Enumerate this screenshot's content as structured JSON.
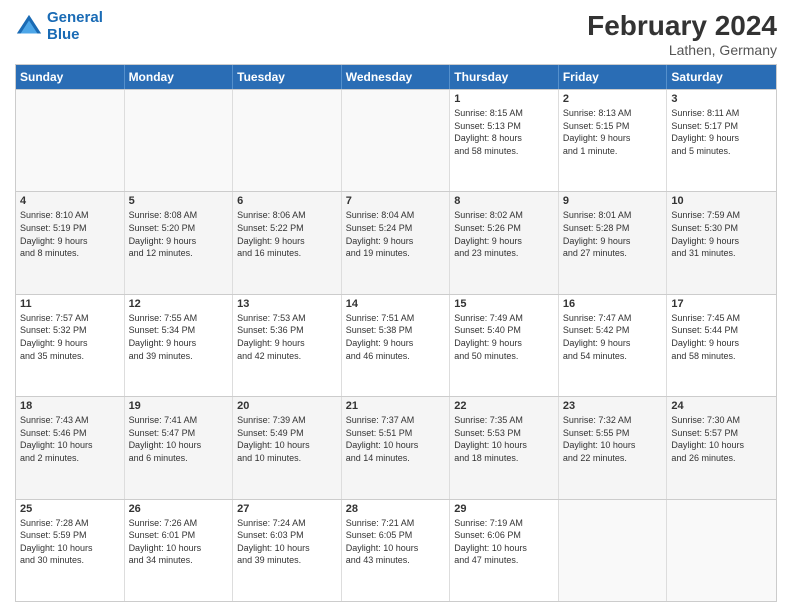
{
  "logo": {
    "line1": "General",
    "line2": "Blue"
  },
  "title": "February 2024",
  "location": "Lathen, Germany",
  "days_header": [
    "Sunday",
    "Monday",
    "Tuesday",
    "Wednesday",
    "Thursday",
    "Friday",
    "Saturday"
  ],
  "weeks": [
    [
      {
        "day": "",
        "info": ""
      },
      {
        "day": "",
        "info": ""
      },
      {
        "day": "",
        "info": ""
      },
      {
        "day": "",
        "info": ""
      },
      {
        "day": "1",
        "info": "Sunrise: 8:15 AM\nSunset: 5:13 PM\nDaylight: 8 hours\nand 58 minutes."
      },
      {
        "day": "2",
        "info": "Sunrise: 8:13 AM\nSunset: 5:15 PM\nDaylight: 9 hours\nand 1 minute."
      },
      {
        "day": "3",
        "info": "Sunrise: 8:11 AM\nSunset: 5:17 PM\nDaylight: 9 hours\nand 5 minutes."
      }
    ],
    [
      {
        "day": "4",
        "info": "Sunrise: 8:10 AM\nSunset: 5:19 PM\nDaylight: 9 hours\nand 8 minutes."
      },
      {
        "day": "5",
        "info": "Sunrise: 8:08 AM\nSunset: 5:20 PM\nDaylight: 9 hours\nand 12 minutes."
      },
      {
        "day": "6",
        "info": "Sunrise: 8:06 AM\nSunset: 5:22 PM\nDaylight: 9 hours\nand 16 minutes."
      },
      {
        "day": "7",
        "info": "Sunrise: 8:04 AM\nSunset: 5:24 PM\nDaylight: 9 hours\nand 19 minutes."
      },
      {
        "day": "8",
        "info": "Sunrise: 8:02 AM\nSunset: 5:26 PM\nDaylight: 9 hours\nand 23 minutes."
      },
      {
        "day": "9",
        "info": "Sunrise: 8:01 AM\nSunset: 5:28 PM\nDaylight: 9 hours\nand 27 minutes."
      },
      {
        "day": "10",
        "info": "Sunrise: 7:59 AM\nSunset: 5:30 PM\nDaylight: 9 hours\nand 31 minutes."
      }
    ],
    [
      {
        "day": "11",
        "info": "Sunrise: 7:57 AM\nSunset: 5:32 PM\nDaylight: 9 hours\nand 35 minutes."
      },
      {
        "day": "12",
        "info": "Sunrise: 7:55 AM\nSunset: 5:34 PM\nDaylight: 9 hours\nand 39 minutes."
      },
      {
        "day": "13",
        "info": "Sunrise: 7:53 AM\nSunset: 5:36 PM\nDaylight: 9 hours\nand 42 minutes."
      },
      {
        "day": "14",
        "info": "Sunrise: 7:51 AM\nSunset: 5:38 PM\nDaylight: 9 hours\nand 46 minutes."
      },
      {
        "day": "15",
        "info": "Sunrise: 7:49 AM\nSunset: 5:40 PM\nDaylight: 9 hours\nand 50 minutes."
      },
      {
        "day": "16",
        "info": "Sunrise: 7:47 AM\nSunset: 5:42 PM\nDaylight: 9 hours\nand 54 minutes."
      },
      {
        "day": "17",
        "info": "Sunrise: 7:45 AM\nSunset: 5:44 PM\nDaylight: 9 hours\nand 58 minutes."
      }
    ],
    [
      {
        "day": "18",
        "info": "Sunrise: 7:43 AM\nSunset: 5:46 PM\nDaylight: 10 hours\nand 2 minutes."
      },
      {
        "day": "19",
        "info": "Sunrise: 7:41 AM\nSunset: 5:47 PM\nDaylight: 10 hours\nand 6 minutes."
      },
      {
        "day": "20",
        "info": "Sunrise: 7:39 AM\nSunset: 5:49 PM\nDaylight: 10 hours\nand 10 minutes."
      },
      {
        "day": "21",
        "info": "Sunrise: 7:37 AM\nSunset: 5:51 PM\nDaylight: 10 hours\nand 14 minutes."
      },
      {
        "day": "22",
        "info": "Sunrise: 7:35 AM\nSunset: 5:53 PM\nDaylight: 10 hours\nand 18 minutes."
      },
      {
        "day": "23",
        "info": "Sunrise: 7:32 AM\nSunset: 5:55 PM\nDaylight: 10 hours\nand 22 minutes."
      },
      {
        "day": "24",
        "info": "Sunrise: 7:30 AM\nSunset: 5:57 PM\nDaylight: 10 hours\nand 26 minutes."
      }
    ],
    [
      {
        "day": "25",
        "info": "Sunrise: 7:28 AM\nSunset: 5:59 PM\nDaylight: 10 hours\nand 30 minutes."
      },
      {
        "day": "26",
        "info": "Sunrise: 7:26 AM\nSunset: 6:01 PM\nDaylight: 10 hours\nand 34 minutes."
      },
      {
        "day": "27",
        "info": "Sunrise: 7:24 AM\nSunset: 6:03 PM\nDaylight: 10 hours\nand 39 minutes."
      },
      {
        "day": "28",
        "info": "Sunrise: 7:21 AM\nSunset: 6:05 PM\nDaylight: 10 hours\nand 43 minutes."
      },
      {
        "day": "29",
        "info": "Sunrise: 7:19 AM\nSunset: 6:06 PM\nDaylight: 10 hours\nand 47 minutes."
      },
      {
        "day": "",
        "info": ""
      },
      {
        "day": "",
        "info": ""
      }
    ]
  ]
}
